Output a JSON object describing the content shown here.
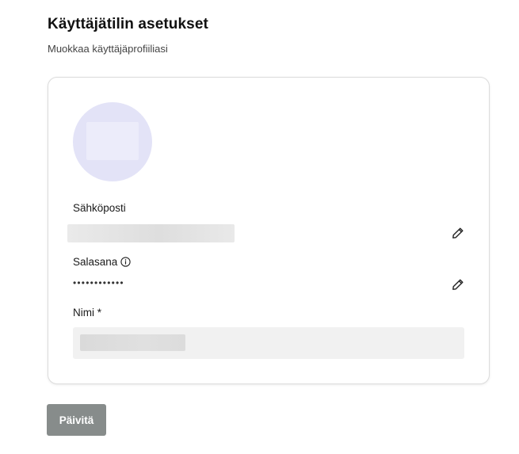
{
  "header": {
    "title": "Käyttäjätilin asetukset",
    "subtitle": "Muokkaa käyttäjäprofiiliasi"
  },
  "profile": {
    "avatar_icon": "user-avatar-placeholder",
    "email": {
      "label": "Sähköposti",
      "edit_icon": "pencil-icon"
    },
    "password": {
      "label": "Salasana",
      "info_icon": "info-icon",
      "value": "••••••••••••",
      "edit_icon": "pencil-icon"
    },
    "name": {
      "label": "Nimi *"
    }
  },
  "actions": {
    "update_label": "Päivitä"
  },
  "colors": {
    "avatar_bg": "#e3e3f7",
    "button_bg": "#878c8b",
    "input_bg": "#f1f1f1",
    "card_border": "#dcdcdc"
  }
}
